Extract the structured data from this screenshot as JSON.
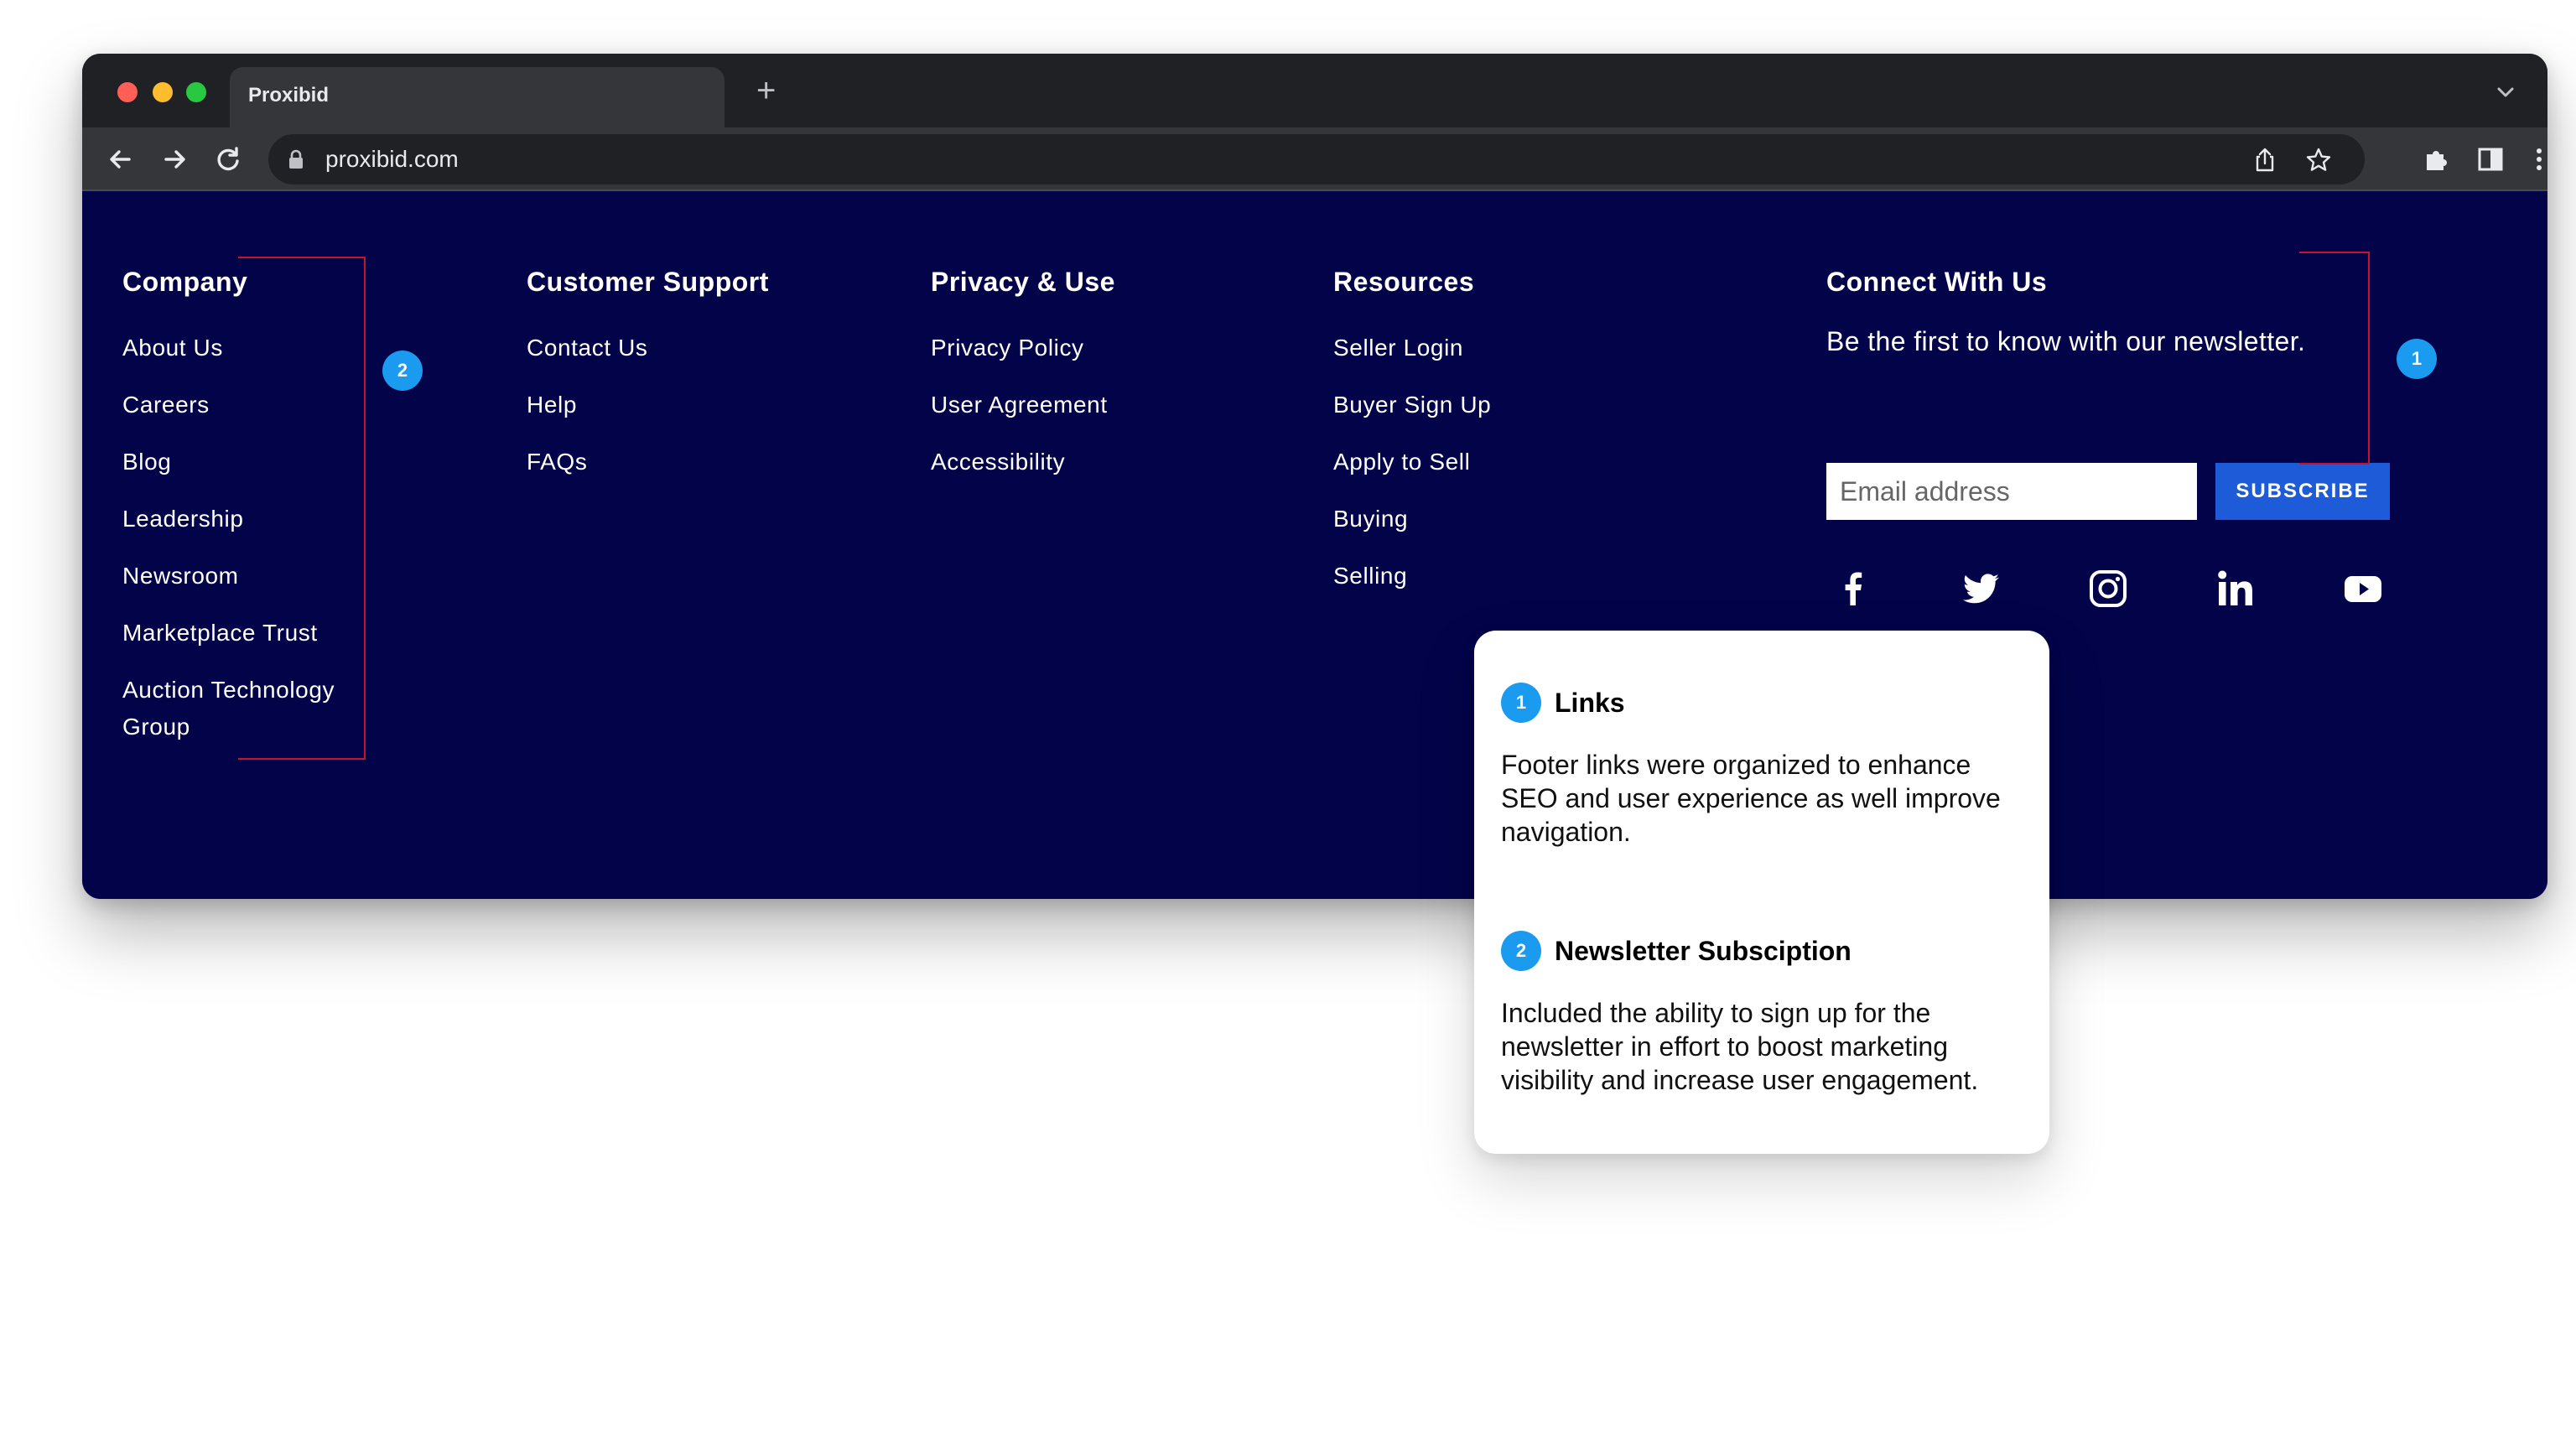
{
  "browser": {
    "tab_title": "Proxibid",
    "new_tab": "+",
    "url": "proxibid.com"
  },
  "footer": {
    "columns": [
      {
        "title": "Company",
        "links": [
          "About Us",
          "Careers",
          "Blog",
          "Leadership",
          "Newsroom",
          "Marketplace Trust",
          "Auction Technology Group"
        ]
      },
      {
        "title": "Customer Support",
        "links": [
          "Contact Us",
          "Help",
          "FAQs"
        ]
      },
      {
        "title": "Privacy & Use",
        "links": [
          "Privacy Policy",
          "User Agreement",
          "Accessibility"
        ]
      },
      {
        "title": "Resources",
        "links": [
          "Seller Login",
          "Buyer Sign Up",
          "Apply to Sell",
          "Buying",
          "Selling"
        ]
      }
    ],
    "connect": {
      "title": "Connect With Us",
      "newsletter_text": "Be the first to know with our newsletter.",
      "email_placeholder": "Email address",
      "subscribe_label": "SUBSCRIBE",
      "social": [
        "facebook-icon",
        "twitter-icon",
        "instagram-icon",
        "linkedin-icon",
        "youtube-icon"
      ]
    },
    "background_color": "#03034a",
    "accent_color": "#1d5bd8"
  },
  "annotations": {
    "marker_1": "1",
    "marker_2": "2",
    "bracket_color": "#c4122f",
    "marker_color": "#1a9bf0"
  },
  "notes": [
    {
      "number": "1",
      "title": "Links",
      "body": "Footer links were organized to enhance SEO and user experience as well improve navigation."
    },
    {
      "number": "2",
      "title": "Newsletter Subsciption",
      "body": "Included the ability to sign up for the newsletter in effort to boost marketing visibility and increase user engagement."
    }
  ]
}
